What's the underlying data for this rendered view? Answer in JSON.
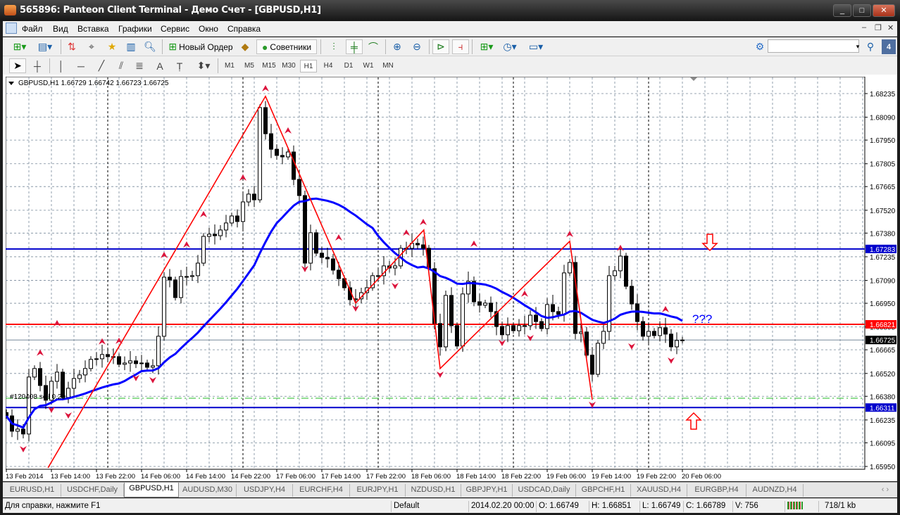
{
  "window": {
    "title": "565896: Panteon Client Terminal - Демо Счет - [GBPUSD,H1]"
  },
  "menu": [
    "Файл",
    "Вид",
    "Вставка",
    "Графики",
    "Сервис",
    "Окно",
    "Справка"
  ],
  "toolbar": {
    "new_order": "Новый Ордер",
    "experts": "Советники",
    "search_placeholder": "",
    "community_badge": "4"
  },
  "timeframes": [
    "M1",
    "M5",
    "M15",
    "M30",
    "H1",
    "H4",
    "D1",
    "W1",
    "MN"
  ],
  "active_timeframe": "H1",
  "chart": {
    "header": "GBPUSD,H1  1.66729 1.66742 1.66723 1.66725",
    "order_label": "#120408 sell 0.20",
    "annotation": "???",
    "colors": {
      "bull": "#ffffff",
      "bear": "#000000",
      "ma": "#0000ff",
      "zigzag": "#ff0000",
      "fractal": "#dc143c",
      "grid": "#778899"
    },
    "price_ticks": [
      "1.68235",
      "1.68090",
      "1.67950",
      "1.67805",
      "1.67665",
      "1.67520",
      "1.67380",
      "1.67235",
      "1.67090",
      "1.66950",
      "1.66805",
      "1.66665",
      "1.66520",
      "1.66380",
      "1.66235",
      "1.66095",
      "1.65950"
    ],
    "time_labels": [
      "13 Feb 2014",
      "13 Feb 14:00",
      "13 Feb 22:00",
      "14 Feb 06:00",
      "14 Feb 14:00",
      "14 Feb 22:00",
      "17 Feb 06:00",
      "17 Feb 14:00",
      "17 Feb 22:00",
      "18 Feb 06:00",
      "18 Feb 14:00",
      "18 Feb 22:00",
      "19 Feb 06:00",
      "19 Feb 14:00",
      "19 Feb 22:00",
      "20 Feb 06:00"
    ],
    "hlines": [
      {
        "price": 1.67283,
        "label": "1.67283",
        "color": "#0000cc"
      },
      {
        "price": 1.66821,
        "label": "1.66821",
        "color": "#ff0000"
      },
      {
        "price": 1.66311,
        "label": "1.66311",
        "color": "#0000cc"
      }
    ],
    "bid": {
      "price": 1.66725,
      "label": "1.66725"
    },
    "order_price": 1.66368,
    "first_open": 1.6628,
    "closes": [
      1.6626,
      1.66166,
      1.66179,
      1.66149,
      1.66498,
      1.6655,
      1.66446,
      1.66356,
      1.66472,
      1.66528,
      1.66373,
      1.66429,
      1.66489,
      1.66511,
      1.6655,
      1.66606,
      1.6661,
      1.66636,
      1.66623,
      1.66623,
      1.66576,
      1.66584,
      1.66597,
      1.6658,
      1.66584,
      1.66558,
      1.66567,
      1.66748,
      1.6711,
      1.67093,
      1.66985,
      1.67114,
      1.67114,
      1.67119,
      1.67196,
      1.6736,
      1.67373,
      1.67364,
      1.67399,
      1.67442,
      1.67485,
      1.67451,
      1.67571,
      1.67619,
      1.67584,
      1.68149,
      1.67989,
      1.67894,
      1.67856,
      1.67847,
      1.67877,
      1.67709,
      1.6761,
      1.67196,
      1.67382,
      1.67257,
      1.67231,
      1.67222,
      1.67153,
      1.67101,
      1.67045,
      1.66972,
      1.66977,
      1.67015,
      1.67045,
      1.67119,
      1.67119,
      1.67179,
      1.67166,
      1.67179,
      1.67287,
      1.67287,
      1.67317,
      1.67308,
      1.67287,
      1.67162,
      1.66826,
      1.66683,
      1.66998,
      1.66813,
      1.66688,
      1.67007,
      1.67084,
      1.66959,
      1.66938,
      1.66951,
      1.66899,
      1.66808,
      1.66757,
      1.66813,
      1.66782,
      1.66813,
      1.66813,
      1.66877,
      1.66838,
      1.66795,
      1.66942,
      1.66899,
      1.66882,
      1.67136,
      1.672,
      1.66765,
      1.66774,
      1.66632,
      1.66515,
      1.66705,
      1.66778,
      1.67119,
      1.67149,
      1.67239,
      1.67054,
      1.66946,
      1.66838,
      1.66748,
      1.66778,
      1.66752,
      1.668,
      1.66761,
      1.66683,
      1.66722,
      1.66725
    ],
    "ma_period": 21,
    "zigzag": [
      [
        7.4,
        1.65942
      ],
      [
        46,
        1.68218
      ],
      [
        62,
        1.66951
      ],
      [
        74.1,
        1.67399
      ],
      [
        77,
        1.6655
      ],
      [
        100,
        1.6733
      ],
      [
        104,
        1.6636
      ]
    ],
    "fractals_up": [
      [
        6,
        1.66645
      ],
      [
        9,
        1.66826
      ],
      [
        17,
        1.66714
      ],
      [
        20,
        1.66718
      ],
      [
        28,
        1.67244
      ],
      [
        32,
        1.67308
      ],
      [
        35,
        1.67494
      ],
      [
        42,
        1.67718
      ],
      [
        46,
        1.68265
      ],
      [
        50,
        1.68007
      ],
      [
        59,
        1.67351
      ],
      [
        71,
        1.67381
      ],
      [
        74,
        1.67446
      ],
      [
        83,
        1.67313
      ],
      [
        92,
        1.67007
      ],
      [
        100,
        1.67373
      ],
      [
        109,
        1.67287
      ],
      [
        117,
        1.66912
      ]
    ],
    "fractals_down": [
      [
        3,
        1.66058
      ],
      [
        8,
        1.663
      ],
      [
        11,
        1.66265
      ],
      [
        23,
        1.66494
      ],
      [
        26,
        1.66481
      ],
      [
        53,
        1.67162
      ],
      [
        62,
        1.6692
      ],
      [
        69,
        1.67058
      ],
      [
        77,
        1.66515
      ],
      [
        88,
        1.66709
      ],
      [
        93,
        1.66739
      ],
      [
        104,
        1.6633
      ],
      [
        111,
        1.66688
      ],
      [
        118,
        1.66601
      ]
    ],
    "day_separators": [
      18,
      42,
      66,
      90,
      114
    ]
  },
  "tabs": [
    "EURUSD,H1",
    "USDCHF,Daily",
    "GBPUSD,H1",
    "AUDUSD,M30",
    "USDJPY,H4",
    "EURCHF,H4",
    "EURJPY,H1",
    "NZDUSD,H1",
    "GBPJPY,H1",
    "USDCAD,Daily",
    "GBPCHF,H1",
    "XAUUSD,H4",
    "EURGBP,H4",
    "AUDNZD,H4"
  ],
  "active_tab": "GBPUSD,H1",
  "status": {
    "help": "Для справки, нажмите F1",
    "profile": "Default",
    "time": "2014.02.20 00:00",
    "open": "O: 1.66749",
    "high": "H: 1.66851",
    "low": "L: 1.66749",
    "close": "C: 1.66789",
    "volume": "V: 756",
    "traffic": "718/1 kb"
  }
}
